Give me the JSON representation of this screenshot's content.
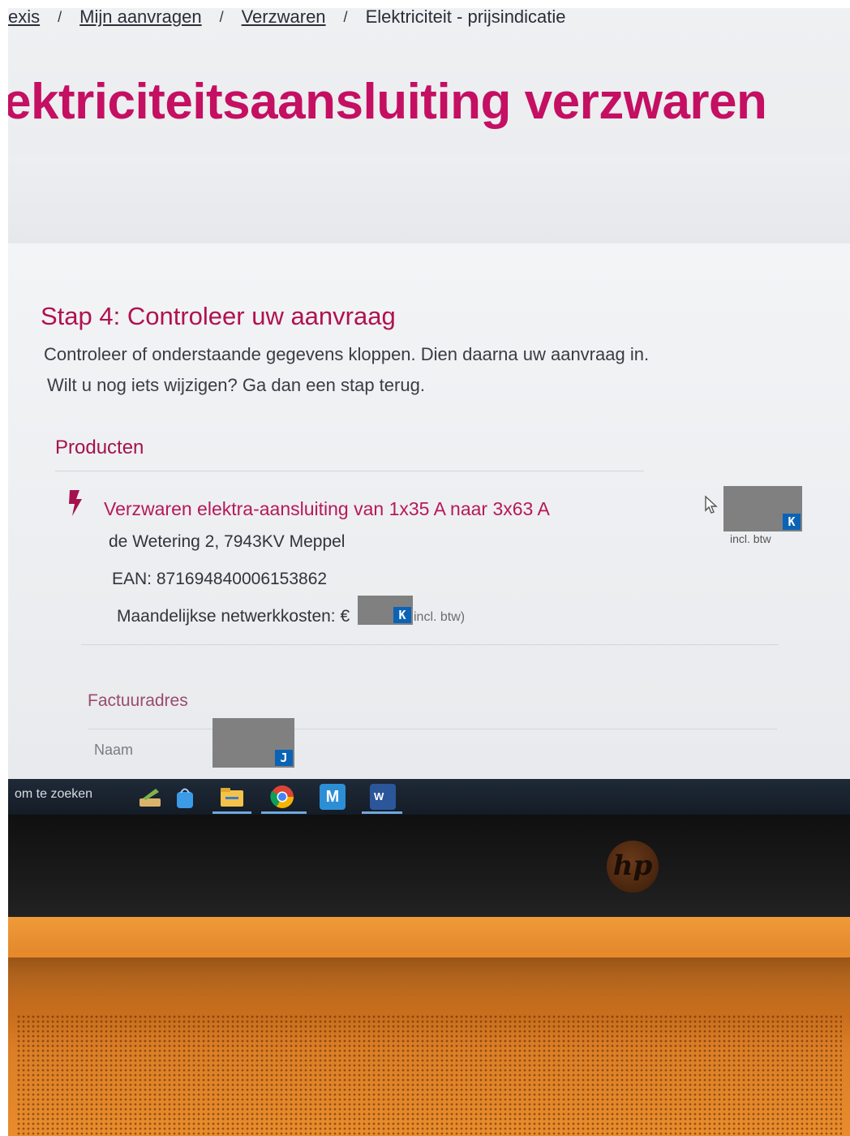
{
  "breadcrumb": [
    {
      "label": "exis",
      "link": true
    },
    {
      "label": "Mijn aanvragen",
      "link": true
    },
    {
      "label": "Verzwaren",
      "link": true
    },
    {
      "label": "Elektriciteit - prijsindicatie",
      "link": false
    }
  ],
  "breadcrumb_separator": "/",
  "page_title": "ektriciteitsaansluiting verzwaren",
  "step": {
    "title": "Stap 4: Controleer uw aanvraag",
    "line1": "Controleer of onderstaande gegevens kloppen. Dien daarna uw aanvraag in.",
    "line2": "Wilt u nog iets wijzigen? Ga dan een stap terug."
  },
  "products": {
    "section_title": "Producten",
    "item_title": "Verzwaren elektra-aansluiting van 1x35 A naar 3x63 A",
    "address": "de Wetering 2, 7943KV Meppel",
    "ean": "EAN: 871694840006153862",
    "monthly_label": "Maandelijkse netwerkkosten: €",
    "monthly_suffix": "incl. btw)",
    "price_suffix": "incl. btw",
    "redaction_tag_price": "K",
    "redaction_tag_monthly": "K"
  },
  "billing": {
    "title": "Factuuradres",
    "name_label": "Naam",
    "redaction_tag_name": "J"
  },
  "taskbar": {
    "search_text": "om te zoeken",
    "mail_letter": "M",
    "word_letter": "W"
  },
  "brand": {
    "laptop_logo": "hp",
    "accent": "#c40f62"
  }
}
